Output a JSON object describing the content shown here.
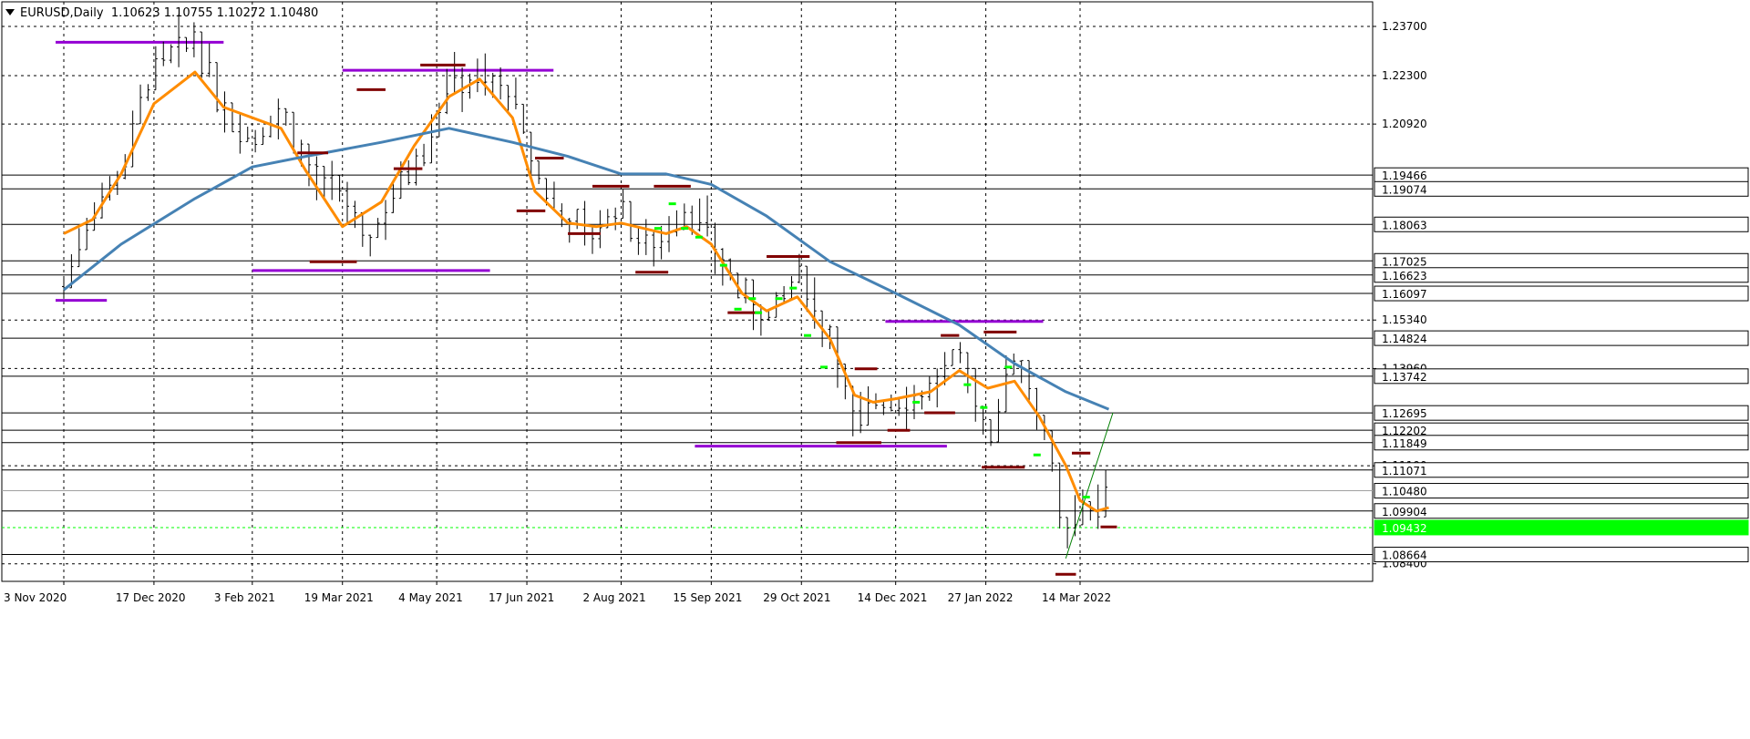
{
  "header": {
    "symbol_text": "EURUSD,Daily",
    "ohlc_text": "1.10623 1.10755 1.10272 1.10480"
  },
  "colors": {
    "bar": "#000000",
    "ma_fast": "#ff8c00",
    "ma_slow": "#4682b4",
    "support_resistance": "#800000",
    "range_line": "#9400d3",
    "fractal": "#00ff00",
    "trendline": "#008000",
    "current_price": "#00ff00",
    "grid": "#000000"
  },
  "chart_data": {
    "type": "line",
    "title": "",
    "xlabel": "",
    "ylabel": "",
    "ylim": [
      1.079,
      1.244
    ],
    "grid": true,
    "x_ticks": [
      "3 Nov 2020",
      "17 Dec 2020",
      "3 Feb 2021",
      "19 Mar 2021",
      "4 May 2021",
      "17 Jun 2021",
      "2 Aug 2021",
      "15 Sep 2021",
      "29 Oct 2021",
      "14 Dec 2021",
      "27 Jan 2022",
      "14 Mar 2022"
    ],
    "y_ticks": [
      "1.23700",
      "1.22300",
      "1.20920",
      "1.15340",
      "1.13960",
      "1.11190",
      "1.08400"
    ],
    "series": [
      {
        "name": "",
        "style": "price-bars",
        "x": [
          "2020-11-03",
          "2020-11-17",
          "2020-12-01",
          "2020-12-10",
          "2020-12-17",
          "2021-01-06",
          "2021-01-20",
          "2021-02-03",
          "2021-02-17",
          "2021-03-01",
          "2021-03-10",
          "2021-03-19",
          "2021-03-31",
          "2021-04-15",
          "2021-04-30",
          "2021-05-10",
          "2021-05-25",
          "2021-06-10",
          "2021-06-21",
          "2021-07-07",
          "2021-07-21",
          "2021-08-02",
          "2021-08-11",
          "2021-08-24",
          "2021-09-03",
          "2021-09-15",
          "2021-09-30",
          "2021-10-12",
          "2021-10-27",
          "2021-11-12",
          "2021-11-24",
          "2021-12-03",
          "2021-12-14",
          "2021-12-31",
          "2022-01-14",
          "2022-01-28",
          "2022-02-10",
          "2022-02-22",
          "2022-03-07",
          "2022-03-14",
          "2022-03-22",
          "2022-03-28"
        ],
        "values": [
          1.163,
          1.185,
          1.195,
          1.215,
          1.225,
          1.233,
          1.215,
          1.205,
          1.213,
          1.198,
          1.19,
          1.19,
          1.174,
          1.192,
          1.205,
          1.222,
          1.222,
          1.218,
          1.195,
          1.182,
          1.178,
          1.187,
          1.175,
          1.177,
          1.187,
          1.177,
          1.16,
          1.153,
          1.166,
          1.15,
          1.122,
          1.131,
          1.13,
          1.133,
          1.143,
          1.12,
          1.144,
          1.131,
          1.089,
          1.103,
          1.098,
          1.105
        ]
      },
      {
        "name": "",
        "style": "ma-fast",
        "x": [
          "2020-11-03",
          "2020-11-17",
          "2020-12-01",
          "2020-12-17",
          "2021-01-06",
          "2021-01-20",
          "2021-02-03",
          "2021-02-17",
          "2021-03-01",
          "2021-03-19",
          "2021-04-07",
          "2021-04-23",
          "2021-05-10",
          "2021-05-25",
          "2021-06-10",
          "2021-06-21",
          "2021-07-07",
          "2021-07-21",
          "2021-08-02",
          "2021-08-24",
          "2021-09-03",
          "2021-09-15",
          "2021-09-30",
          "2021-10-12",
          "2021-10-27",
          "2021-11-12",
          "2021-11-24",
          "2021-12-03",
          "2021-12-14",
          "2021-12-31",
          "2022-01-14",
          "2022-01-28",
          "2022-02-10",
          "2022-02-22",
          "2022-03-07",
          "2022-03-14",
          "2022-03-22",
          "2022-03-28"
        ],
        "values": [
          1.178,
          1.182,
          1.195,
          1.215,
          1.224,
          1.214,
          1.211,
          1.208,
          1.196,
          1.18,
          1.187,
          1.203,
          1.217,
          1.222,
          1.211,
          1.19,
          1.181,
          1.18,
          1.181,
          1.178,
          1.18,
          1.175,
          1.161,
          1.156,
          1.16,
          1.148,
          1.132,
          1.13,
          1.131,
          1.133,
          1.139,
          1.134,
          1.136,
          1.126,
          1.112,
          1.102,
          1.099,
          1.1
        ]
      },
      {
        "name": "",
        "style": "ma-slow",
        "x": [
          "2020-11-03",
          "2020-12-01",
          "2021-01-06",
          "2021-02-03",
          "2021-03-01",
          "2021-04-07",
          "2021-05-10",
          "2021-06-10",
          "2021-07-07",
          "2021-08-02",
          "2021-08-24",
          "2021-09-15",
          "2021-10-12",
          "2021-11-12",
          "2021-12-14",
          "2022-01-14",
          "2022-02-10",
          "2022-03-07",
          "2022-03-28"
        ],
        "values": [
          1.162,
          1.175,
          1.188,
          1.197,
          1.2,
          1.204,
          1.208,
          1.204,
          1.2,
          1.195,
          1.195,
          1.192,
          1.183,
          1.17,
          1.161,
          1.152,
          1.141,
          1.133,
          1.128
        ]
      },
      {
        "name": "",
        "style": "trendline",
        "x": [
          "2022-03-07",
          "2022-03-30"
        ],
        "values": [
          1.0855,
          1.127
        ]
      }
    ],
    "horizontal_levels": [
      {
        "label": "1.19466",
        "value": 1.19466
      },
      {
        "label": "1.19074",
        "value": 1.19074
      },
      {
        "label": "1.18063",
        "value": 1.18063
      },
      {
        "label": "1.17025",
        "value": 1.17025
      },
      {
        "label": "1.16623",
        "value": 1.16623
      },
      {
        "label": "1.16097",
        "value": 1.16097
      },
      {
        "label": "1.14824",
        "value": 1.14824
      },
      {
        "label": "1.13742",
        "value": 1.13742
      },
      {
        "label": "1.12695",
        "value": 1.12695
      },
      {
        "label": "1.12202",
        "value": 1.12202
      },
      {
        "label": "1.11849",
        "value": 1.11849
      },
      {
        "label": "1.11071",
        "value": 1.11071
      },
      {
        "label": "1.10480",
        "value": 1.1048
      },
      {
        "label": "1.09904",
        "value": 1.09904
      },
      {
        "label": "1.09432",
        "value": 1.09432
      },
      {
        "label": "1.08664",
        "value": 1.08664
      }
    ],
    "current_price": "1.10480",
    "fractal_level": "1.09432",
    "range_lines": [
      {
        "value": 1.2325,
        "x_start": "2020-10-30",
        "x_end": "2021-01-20"
      },
      {
        "value": 1.2245,
        "x_start": "2021-03-19",
        "x_end": "2021-06-30"
      },
      {
        "value": 1.1675,
        "x_start": "2021-02-03",
        "x_end": "2021-05-30"
      },
      {
        "value": 1.159,
        "x_start": "2020-10-30",
        "x_end": "2020-11-24"
      },
      {
        "value": 1.153,
        "x_start": "2021-12-09",
        "x_end": "2022-02-24"
      },
      {
        "value": 1.1175,
        "x_start": "2021-09-07",
        "x_end": "2022-01-08"
      }
    ],
    "support_resistance_marks": [
      {
        "value": 1.219,
        "x_start": "2021-03-26",
        "x_end": "2021-04-09"
      },
      {
        "value": 1.226,
        "x_start": "2021-04-26",
        "x_end": "2021-05-18"
      },
      {
        "value": 1.201,
        "x_start": "2021-02-25",
        "x_end": "2021-03-12"
      },
      {
        "value": 1.1965,
        "x_start": "2021-04-13",
        "x_end": "2021-04-27"
      },
      {
        "value": 1.17,
        "x_start": "2021-03-03",
        "x_end": "2021-03-26"
      },
      {
        "value": 1.1995,
        "x_start": "2021-06-21",
        "x_end": "2021-07-05"
      },
      {
        "value": 1.1845,
        "x_start": "2021-06-12",
        "x_end": "2021-06-26"
      },
      {
        "value": 1.1915,
        "x_start": "2021-07-19",
        "x_end": "2021-08-06"
      },
      {
        "value": 1.1915,
        "x_start": "2021-08-18",
        "x_end": "2021-09-05"
      },
      {
        "value": 1.178,
        "x_start": "2021-07-07",
        "x_end": "2021-07-23"
      },
      {
        "value": 1.167,
        "x_start": "2021-08-09",
        "x_end": "2021-08-25"
      },
      {
        "value": 1.1715,
        "x_start": "2021-10-12",
        "x_end": "2021-11-02"
      },
      {
        "value": 1.1555,
        "x_start": "2021-09-23",
        "x_end": "2021-10-09"
      },
      {
        "value": 1.1395,
        "x_start": "2021-11-24",
        "x_end": "2021-12-05"
      },
      {
        "value": 1.1185,
        "x_start": "2021-11-15",
        "x_end": "2021-12-07"
      },
      {
        "value": 1.122,
        "x_start": "2021-12-10",
        "x_end": "2021-12-21"
      },
      {
        "value": 1.127,
        "x_start": "2021-12-28",
        "x_end": "2022-01-12"
      },
      {
        "value": 1.149,
        "x_start": "2022-01-05",
        "x_end": "2022-01-14"
      },
      {
        "value": 1.15,
        "x_start": "2022-01-26",
        "x_end": "2022-02-11"
      },
      {
        "value": 1.1115,
        "x_start": "2022-01-25",
        "x_end": "2022-02-15"
      },
      {
        "value": 1.1155,
        "x_start": "2022-03-10",
        "x_end": "2022-03-19"
      },
      {
        "value": 1.0945,
        "x_start": "2022-03-24",
        "x_end": "2022-04-01"
      },
      {
        "value": 1.081,
        "x_start": "2022-03-02",
        "x_end": "2022-03-12"
      }
    ],
    "fractal_marks": [
      {
        "x": "2021-08-20",
        "value": 1.1795
      },
      {
        "x": "2021-08-27",
        "value": 1.1865
      },
      {
        "x": "2021-09-02",
        "value": 1.1795
      },
      {
        "x": "2021-09-09",
        "value": 1.177
      },
      {
        "x": "2021-09-21",
        "value": 1.169
      },
      {
        "x": "2021-09-28",
        "value": 1.1565
      },
      {
        "x": "2021-10-05",
        "value": 1.1595
      },
      {
        "x": "2021-10-08",
        "value": 1.1555
      },
      {
        "x": "2021-10-18",
        "value": 1.1595
      },
      {
        "x": "2021-10-25",
        "value": 1.1625
      },
      {
        "x": "2021-11-01",
        "value": 1.149
      },
      {
        "x": "2021-11-09",
        "value": 1.14
      },
      {
        "x": "2021-12-24",
        "value": 1.13
      },
      {
        "x": "2022-01-18",
        "value": 1.135
      },
      {
        "x": "2022-01-26",
        "value": 1.1285
      },
      {
        "x": "2022-02-07",
        "value": 1.14
      },
      {
        "x": "2022-02-21",
        "value": 1.115
      },
      {
        "x": "2022-03-17",
        "value": 1.103
      }
    ]
  }
}
